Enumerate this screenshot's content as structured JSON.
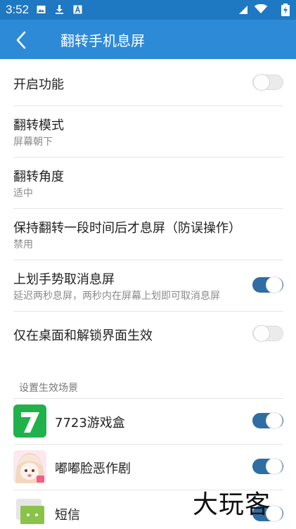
{
  "status": {
    "time": "3:52"
  },
  "header": {
    "title": "翻转手机息屏"
  },
  "settings": [
    {
      "title": "开启功能",
      "toggle": false
    },
    {
      "title": "翻转模式",
      "subtitle": "屏幕朝下"
    },
    {
      "title": "翻转角度",
      "subtitle": "适中"
    },
    {
      "title": "保持翻转一段时间后才息屏（防误操作）",
      "subtitle": "禁用"
    },
    {
      "title": "上划手势取消息屏",
      "subtitle": "延迟两秒息屏，两秒内在屏幕上划即可取消息屏",
      "toggle": true
    },
    {
      "title": "仅在桌面和解锁界面生效",
      "toggle": false
    }
  ],
  "scene": {
    "section_title": "设置生效场景",
    "apps": [
      {
        "name": "7723游戏盒",
        "enabled": true,
        "icon": "7723-app-icon"
      },
      {
        "name": "嘟嘟脸恶作剧",
        "enabled": true,
        "icon": "anime-girl-app-icon"
      },
      {
        "name": "短信",
        "enabled": true,
        "icon": "sms-app-icon"
      }
    ]
  },
  "watermark": "大玩客",
  "colors": {
    "statusbar": "#1e78c2",
    "appbar": "#2d8ad7",
    "toggle_on": "#2f6da3"
  }
}
